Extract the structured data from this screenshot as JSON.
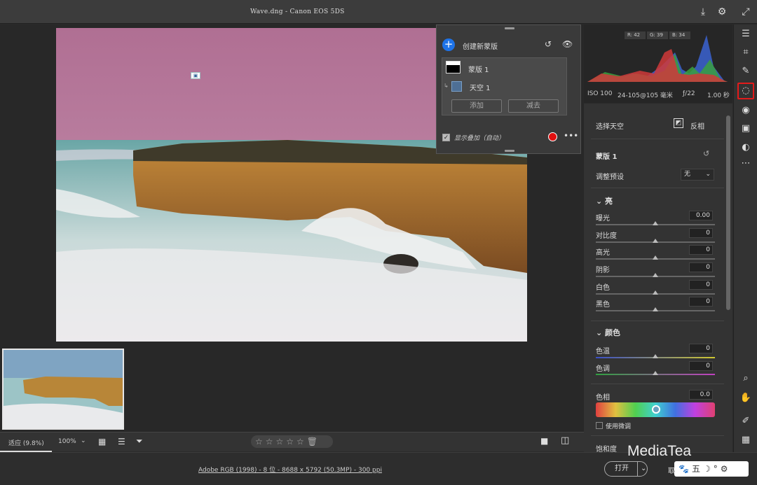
{
  "window": {
    "title": "Wave.dng - Canon EOS 5DS"
  },
  "mask_panel": {
    "create_label": "创建新蒙版",
    "mask_name": "蒙版 1",
    "component_name": "天空 1",
    "add_label": "添加",
    "subtract_label": "减去",
    "overlay_label": "显示叠加（自动）",
    "overlay_color": "#e01010"
  },
  "histogram": {
    "r": "R: 42",
    "g": "G: 39",
    "b": "B: 34"
  },
  "exif": {
    "iso": "ISO 100",
    "lens": "24-105@105 毫米",
    "aperture": "ƒ/22",
    "shutter": "1.00 秒"
  },
  "right_panel": {
    "select_sky": "选择天空",
    "invert": "反相",
    "mask_title": "蒙版 1",
    "preset_label": "调整预设",
    "preset_value": "无",
    "light_section": "亮",
    "exposure": {
      "label": "曝光",
      "value": "0.00"
    },
    "contrast": {
      "label": "对比度",
      "value": "0"
    },
    "highlights": {
      "label": "高光",
      "value": "0"
    },
    "shadows": {
      "label": "阴影",
      "value": "0"
    },
    "whites": {
      "label": "白色",
      "value": "0"
    },
    "blacks": {
      "label": "黑色",
      "value": "0"
    },
    "color_section": "颜色",
    "temp": {
      "label": "色温",
      "value": "0"
    },
    "tint": {
      "label": "色调",
      "value": "0"
    },
    "hue": {
      "label": "色相",
      "value": "0.0"
    },
    "fine_label": "使用微调",
    "saturation": {
      "label": "饱和度"
    }
  },
  "status": {
    "fit_label": "适应 (9.8%)",
    "zoom_label": "100%"
  },
  "footer": {
    "info": "Adobe RGB (1998) - 8 位 - 8688 x 5792 (50.3MP) - 300 ppi",
    "open_label": "打开",
    "watermark": "MediaTea",
    "partial": "取"
  },
  "icons": [
    "search-icon",
    "hand-icon",
    "gear-icon",
    "expand-icon",
    "save-icon",
    "edit-sliders-icon",
    "crop-icon",
    "brush-icon",
    "mask-icon",
    "redeye-icon",
    "presets-icon",
    "snapshot-icon",
    "more-icon",
    "eyedropper-icon",
    "grid-icon"
  ]
}
